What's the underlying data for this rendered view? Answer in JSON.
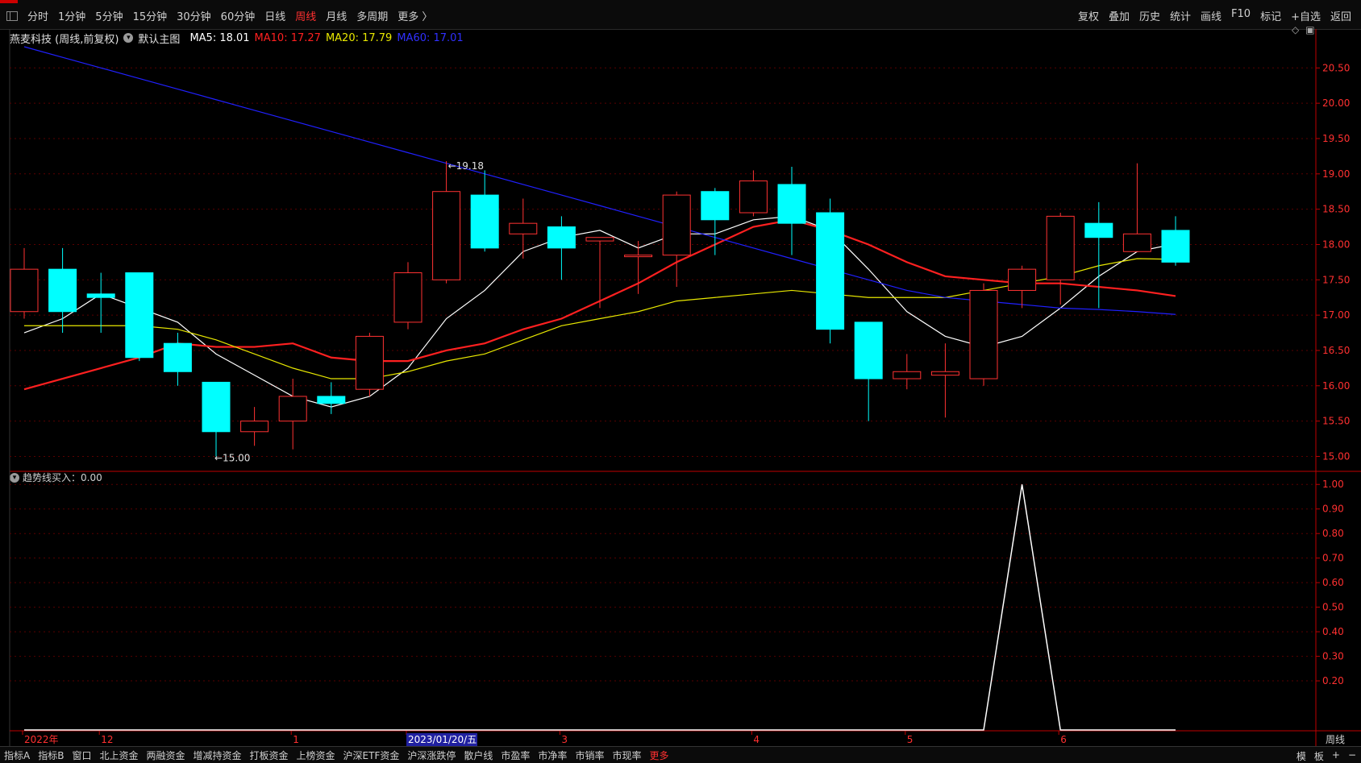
{
  "toolbar": {
    "periods": [
      "分时",
      "1分钟",
      "5分钟",
      "15分钟",
      "30分钟",
      "60分钟",
      "日线",
      "周线",
      "月线",
      "多周期",
      "更多 〉"
    ],
    "active_period": "周线",
    "right_buttons": [
      "复权",
      "叠加",
      "历史",
      "统计",
      "画线",
      "F10",
      "标记",
      "+自选",
      "返回"
    ]
  },
  "info": {
    "stock": "燕麦科技 (周线,前复权)",
    "template": "默认主图",
    "ma5": "MA5: 18.01",
    "ma10": "MA10: 17.27",
    "ma20": "MA20: 17.79",
    "ma60": "MA60: 17.01"
  },
  "indicator": {
    "label": "趋势线买入：0.00"
  },
  "annotations": {
    "high": "19.18",
    "low": "15.00"
  },
  "time_axis": {
    "labels": [
      "2022年",
      "12",
      "1",
      "2023/01/20/五",
      "3",
      "4",
      "5",
      "6"
    ],
    "period": "周线"
  },
  "colors": {
    "up": "#ff3232",
    "down": "#00ffff",
    "ma5": "#ffffff",
    "ma10": "#ff2020",
    "ma20": "#e8e800",
    "ma60": "#2020ff",
    "axis": "#c00000"
  },
  "bottom_tabs": [
    "指标A",
    "指标B",
    "窗口",
    "北上资金",
    "两融资金",
    "增减持资金",
    "打板资金",
    "上榜资金",
    "沪深ETF资金",
    "沪深涨跌停",
    "散户线",
    "市盈率",
    "市净率",
    "市销率",
    "市现率",
    "更多"
  ],
  "bottom_active": "更多",
  "bottom_right": [
    "模",
    "板",
    "+",
    "−"
  ],
  "chart_data": [
    {
      "type": "candlestick",
      "title": "燕麦科技 (周线,前复权)",
      "ylim": [
        14.8,
        20.8
      ],
      "yticks": [
        "15.00",
        "15.50",
        "16.00",
        "16.50",
        "17.00",
        "17.50",
        "18.00",
        "18.50",
        "19.00",
        "19.50",
        "20.00",
        "20.50"
      ],
      "candles": [
        {
          "o": 17.05,
          "h": 17.95,
          "l": 16.95,
          "c": 17.65
        },
        {
          "o": 17.65,
          "h": 17.95,
          "l": 16.75,
          "c": 17.05
        },
        {
          "o": 17.3,
          "h": 17.6,
          "l": 16.75,
          "c": 17.25
        },
        {
          "o": 17.6,
          "h": 17.6,
          "l": 16.35,
          "c": 16.4
        },
        {
          "o": 16.6,
          "h": 16.75,
          "l": 16.0,
          "c": 16.2
        },
        {
          "o": 16.05,
          "h": 16.05,
          "l": 15.0,
          "c": 15.35
        },
        {
          "o": 15.35,
          "h": 15.7,
          "l": 15.15,
          "c": 15.5
        },
        {
          "o": 15.5,
          "h": 16.1,
          "l": 15.1,
          "c": 15.85
        },
        {
          "o": 15.85,
          "h": 16.05,
          "l": 15.6,
          "c": 15.75
        },
        {
          "o": 15.95,
          "h": 16.75,
          "l": 15.85,
          "c": 16.7
        },
        {
          "o": 16.9,
          "h": 17.75,
          "l": 16.8,
          "c": 17.6
        },
        {
          "o": 17.5,
          "h": 19.18,
          "l": 17.45,
          "c": 18.75
        },
        {
          "o": 18.7,
          "h": 19.05,
          "l": 17.9,
          "c": 17.95
        },
        {
          "o": 18.15,
          "h": 18.65,
          "l": 17.8,
          "c": 18.3
        },
        {
          "o": 18.25,
          "h": 18.4,
          "l": 17.5,
          "c": 17.95
        },
        {
          "o": 18.05,
          "h": 18.1,
          "l": 17.1,
          "c": 18.1
        },
        {
          "o": 17.85,
          "h": 18.05,
          "l": 17.3,
          "c": 17.85
        },
        {
          "o": 17.85,
          "h": 18.75,
          "l": 17.4,
          "c": 18.7
        },
        {
          "o": 18.75,
          "h": 18.8,
          "l": 17.85,
          "c": 18.35
        },
        {
          "o": 18.45,
          "h": 19.05,
          "l": 18.4,
          "c": 18.9
        },
        {
          "o": 18.85,
          "h": 19.1,
          "l": 17.85,
          "c": 18.3
        },
        {
          "o": 18.45,
          "h": 18.65,
          "l": 16.6,
          "c": 16.8
        },
        {
          "o": 16.9,
          "h": 16.9,
          "l": 15.5,
          "c": 16.1
        },
        {
          "o": 16.1,
          "h": 16.45,
          "l": 15.95,
          "c": 16.2
        },
        {
          "o": 16.15,
          "h": 16.6,
          "l": 15.55,
          "c": 16.2
        },
        {
          "o": 16.1,
          "h": 17.45,
          "l": 16.0,
          "c": 17.35
        },
        {
          "o": 17.35,
          "h": 17.7,
          "l": 17.1,
          "c": 17.65
        },
        {
          "o": 17.5,
          "h": 18.45,
          "l": 17.15,
          "c": 18.4
        },
        {
          "o": 18.3,
          "h": 18.6,
          "l": 17.1,
          "c": 18.1
        },
        {
          "o": 17.9,
          "h": 19.15,
          "l": 17.9,
          "c": 18.15
        },
        {
          "o": 18.2,
          "h": 18.4,
          "l": 17.7,
          "c": 17.75
        }
      ],
      "series": [
        {
          "name": "MA5",
          "values": [
            16.75,
            16.95,
            17.3,
            17.1,
            16.9,
            16.45,
            16.15,
            15.85,
            15.7,
            15.85,
            16.25,
            16.95,
            17.35,
            17.9,
            18.1,
            18.2,
            17.95,
            18.15,
            18.15,
            18.35,
            18.4,
            18.2,
            17.65,
            17.05,
            16.7,
            16.55,
            16.7,
            17.1,
            17.55,
            17.9,
            18.01
          ]
        },
        {
          "name": "MA10",
          "values": [
            15.95,
            16.1,
            16.25,
            16.4,
            16.6,
            16.55,
            16.55,
            16.6,
            16.4,
            16.35,
            16.35,
            16.5,
            16.6,
            16.8,
            16.95,
            17.2,
            17.45,
            17.75,
            18.0,
            18.25,
            18.35,
            18.2,
            18.0,
            17.75,
            17.55,
            17.5,
            17.45,
            17.45,
            17.4,
            17.35,
            17.27
          ]
        },
        {
          "name": "MA20",
          "values": [
            16.85,
            16.85,
            16.85,
            16.85,
            16.8,
            16.65,
            16.45,
            16.25,
            16.1,
            16.1,
            16.2,
            16.35,
            16.45,
            16.65,
            16.85,
            16.95,
            17.05,
            17.2,
            17.25,
            17.3,
            17.35,
            17.3,
            17.25,
            17.25,
            17.25,
            17.35,
            17.45,
            17.55,
            17.7,
            17.8,
            17.79
          ]
        },
        {
          "name": "MA60",
          "values": [
            20.8,
            20.65,
            20.5,
            20.35,
            20.2,
            20.05,
            19.9,
            19.75,
            19.6,
            19.45,
            19.3,
            19.15,
            19.0,
            18.85,
            18.7,
            18.55,
            18.4,
            18.25,
            18.1,
            17.95,
            17.8,
            17.65,
            17.5,
            17.35,
            17.25,
            17.2,
            17.15,
            17.1,
            17.08,
            17.05,
            17.01
          ]
        }
      ]
    },
    {
      "type": "line",
      "title": "趋势线买入",
      "ylim": [
        0,
        1.05
      ],
      "yticks": [
        "0.20",
        "0.30",
        "0.40",
        "0.50",
        "0.60",
        "0.70",
        "0.80",
        "0.90",
        "1.00"
      ],
      "series": [
        {
          "name": "趋势线买入",
          "values": [
            0,
            0,
            0,
            0,
            0,
            0,
            0,
            0,
            0,
            0,
            0,
            0,
            0,
            0,
            0,
            0,
            0,
            0,
            0,
            0,
            0,
            0,
            0,
            0,
            0,
            0,
            1,
            0,
            0,
            0,
            0
          ]
        }
      ]
    }
  ]
}
